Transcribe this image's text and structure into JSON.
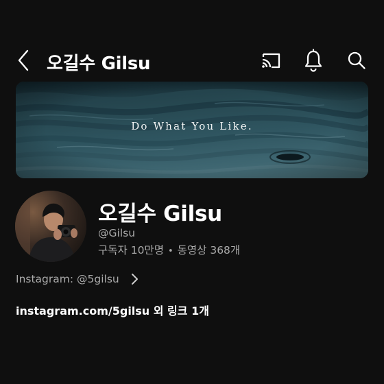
{
  "header": {
    "title": "오길수 Gilsu",
    "icons": [
      "back-icon",
      "cast-icon",
      "bell-icon",
      "search-icon"
    ]
  },
  "banner": {
    "text": "Do What You Like."
  },
  "channel": {
    "name": "오길수 Gilsu",
    "handle": "@Gilsu",
    "subscribers": "구독자 10만명",
    "separator": "•",
    "videos": "동영상 368개"
  },
  "about": {
    "label": "Instagram: @5gilsu"
  },
  "links": {
    "text": "instagram.com/5gilsu 외 링크 1개"
  },
  "colors": {
    "background": "#0f0f0f",
    "primary_text": "#ffffff",
    "secondary_text": "#aaaaaa"
  }
}
